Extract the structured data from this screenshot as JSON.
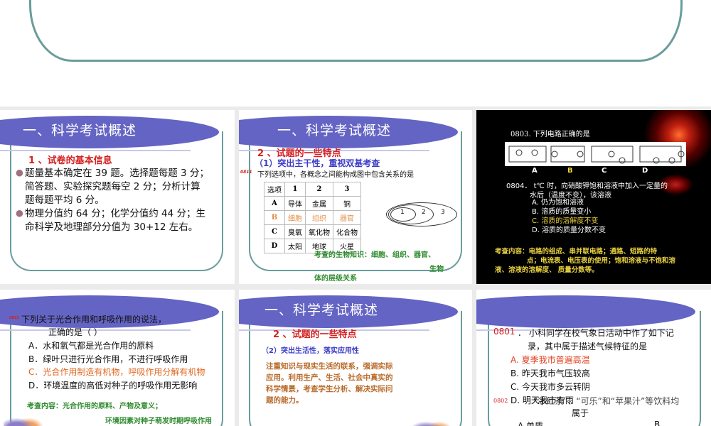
{
  "slide1": {
    "title": "一、科学考试概述",
    "heading": "1 、试卷的基本信息",
    "bullets": [
      "题量基本确定在 39 题。选择题每题 3 分；",
      "简答题、实验探究题每空 2 分；分析计算",
      "题每题平均 6 分。",
      "物理分值约 64 分；化学分值约 44 分；生",
      "命科学及地理部分分值为 30+12 左右。"
    ]
  },
  "slide2": {
    "title": "一、科学考试概述",
    "heading": "2 、试题的一些特点",
    "sub": "（1）突出主干性，重视双基考查",
    "qnum": "0811",
    "question": "下列选项中，各概念之间能构成图中包含关系的是",
    "table": {
      "headers": [
        "选项",
        "1",
        "2",
        "3"
      ],
      "rows": [
        [
          "A",
          "导体",
          "金属",
          "铜"
        ],
        [
          "B",
          "细胞",
          "组织",
          "器官"
        ],
        [
          "C",
          "臭氧",
          "氧化物",
          "化合物"
        ],
        [
          "D",
          "太阳",
          "地球",
          "火星"
        ]
      ]
    },
    "diagram": [
      "1",
      "2",
      "3"
    ],
    "note1": "考查的生物知识：细胞、组织、器官、",
    "note2": "生物",
    "note3": "体的层级关系"
  },
  "slide3": {
    "q1": "0803. 下列电路正确的是",
    "circuit_labels": [
      "A",
      "B",
      "C",
      "D"
    ],
    "q2a": "0804．  t℃ 时，向硝酸钾饱和溶液中加入一定量的",
    "q2b": "水后（温度不变），该溶液",
    "options": [
      "A.  仍为饱和溶液",
      "B.  溶质的质量变小",
      "C.  溶质的溶解度不变",
      "D.  溶质的质量分数不变"
    ],
    "note1": "考查内容：电路的组成、串并联电路；通路、短路的特",
    "note2": "点；电流表、电压表的使用；饱和溶液与不饱和溶",
    "note3": "液、溶液的溶解度、    质量分数等。"
  },
  "slide4": {
    "qnum": "0815",
    "q1": "下列关于光合作用和呼吸作用的说法，",
    "q2": "正确的是（        ）",
    "options": [
      "A．水和氧气都是光合作用的原料",
      "B．绿叶只进行光合作用，不进行呼吸作用",
      "C．光合作用制造有机物，呼吸作用分解有机物",
      "D．环境温度的高低对种子的呼吸作用无影响"
    ],
    "note1": "考查内容：光合作用的原料、产物及意义；",
    "note2": "环境因素对种子萌发时期呼吸作用"
  },
  "slide5": {
    "title": "一、科学考试概述",
    "heading": "2 、试题的一些特点",
    "sub": "（2）突出生活性，落实应用性",
    "body": [
      "注重知识与现实生活的联系，强调实际",
      "应用。利用生产、生活、社会中真实的",
      "科学情景，考查学生分析、解决实际问",
      "题的能力。"
    ]
  },
  "slide6": {
    "qnum": "0801",
    "q1": "．  小科同学在校气象日活动中作了如下记",
    "q2": "录，其中属于描述气候特征的是",
    "options": [
      "A.  夏季我市普遍高温",
      "B.  昨天我市气压较高",
      "C.  今天我市多云转阴",
      "D.  明天我市有雨"
    ],
    "qnum2": "0802",
    "q3": "“冰红茶”、“可乐”和“苹果汁”等饮料均",
    "q4": "属于",
    "optA": "A   单质",
    "optB": "B"
  }
}
